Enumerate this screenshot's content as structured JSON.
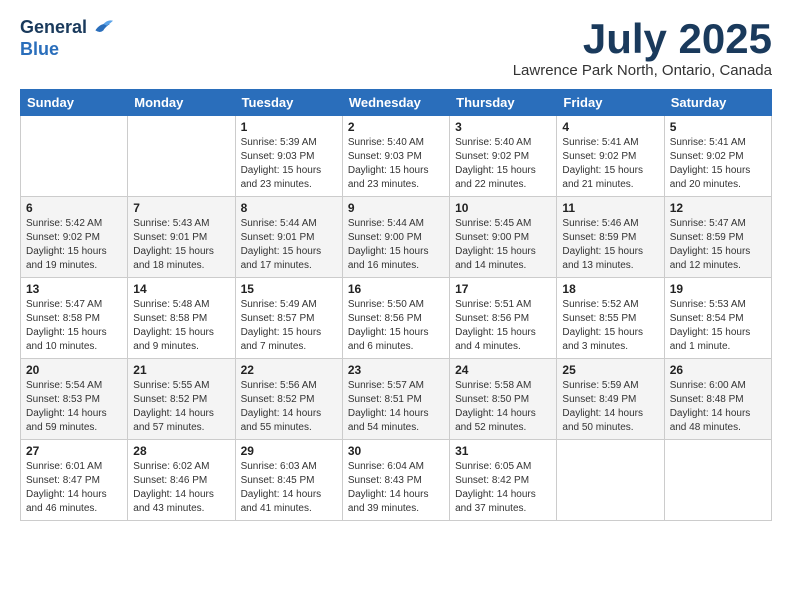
{
  "logo": {
    "general": "General",
    "blue": "Blue"
  },
  "header": {
    "month": "July 2025",
    "location": "Lawrence Park North, Ontario, Canada"
  },
  "weekdays": [
    "Sunday",
    "Monday",
    "Tuesday",
    "Wednesday",
    "Thursday",
    "Friday",
    "Saturday"
  ],
  "weeks": [
    [
      {
        "day": "",
        "sunrise": "",
        "sunset": "",
        "daylight": ""
      },
      {
        "day": "",
        "sunrise": "",
        "sunset": "",
        "daylight": ""
      },
      {
        "day": "1",
        "sunrise": "Sunrise: 5:39 AM",
        "sunset": "Sunset: 9:03 PM",
        "daylight": "Daylight: 15 hours and 23 minutes."
      },
      {
        "day": "2",
        "sunrise": "Sunrise: 5:40 AM",
        "sunset": "Sunset: 9:03 PM",
        "daylight": "Daylight: 15 hours and 23 minutes."
      },
      {
        "day": "3",
        "sunrise": "Sunrise: 5:40 AM",
        "sunset": "Sunset: 9:02 PM",
        "daylight": "Daylight: 15 hours and 22 minutes."
      },
      {
        "day": "4",
        "sunrise": "Sunrise: 5:41 AM",
        "sunset": "Sunset: 9:02 PM",
        "daylight": "Daylight: 15 hours and 21 minutes."
      },
      {
        "day": "5",
        "sunrise": "Sunrise: 5:41 AM",
        "sunset": "Sunset: 9:02 PM",
        "daylight": "Daylight: 15 hours and 20 minutes."
      }
    ],
    [
      {
        "day": "6",
        "sunrise": "Sunrise: 5:42 AM",
        "sunset": "Sunset: 9:02 PM",
        "daylight": "Daylight: 15 hours and 19 minutes."
      },
      {
        "day": "7",
        "sunrise": "Sunrise: 5:43 AM",
        "sunset": "Sunset: 9:01 PM",
        "daylight": "Daylight: 15 hours and 18 minutes."
      },
      {
        "day": "8",
        "sunrise": "Sunrise: 5:44 AM",
        "sunset": "Sunset: 9:01 PM",
        "daylight": "Daylight: 15 hours and 17 minutes."
      },
      {
        "day": "9",
        "sunrise": "Sunrise: 5:44 AM",
        "sunset": "Sunset: 9:00 PM",
        "daylight": "Daylight: 15 hours and 16 minutes."
      },
      {
        "day": "10",
        "sunrise": "Sunrise: 5:45 AM",
        "sunset": "Sunset: 9:00 PM",
        "daylight": "Daylight: 15 hours and 14 minutes."
      },
      {
        "day": "11",
        "sunrise": "Sunrise: 5:46 AM",
        "sunset": "Sunset: 8:59 PM",
        "daylight": "Daylight: 15 hours and 13 minutes."
      },
      {
        "day": "12",
        "sunrise": "Sunrise: 5:47 AM",
        "sunset": "Sunset: 8:59 PM",
        "daylight": "Daylight: 15 hours and 12 minutes."
      }
    ],
    [
      {
        "day": "13",
        "sunrise": "Sunrise: 5:47 AM",
        "sunset": "Sunset: 8:58 PM",
        "daylight": "Daylight: 15 hours and 10 minutes."
      },
      {
        "day": "14",
        "sunrise": "Sunrise: 5:48 AM",
        "sunset": "Sunset: 8:58 PM",
        "daylight": "Daylight: 15 hours and 9 minutes."
      },
      {
        "day": "15",
        "sunrise": "Sunrise: 5:49 AM",
        "sunset": "Sunset: 8:57 PM",
        "daylight": "Daylight: 15 hours and 7 minutes."
      },
      {
        "day": "16",
        "sunrise": "Sunrise: 5:50 AM",
        "sunset": "Sunset: 8:56 PM",
        "daylight": "Daylight: 15 hours and 6 minutes."
      },
      {
        "day": "17",
        "sunrise": "Sunrise: 5:51 AM",
        "sunset": "Sunset: 8:56 PM",
        "daylight": "Daylight: 15 hours and 4 minutes."
      },
      {
        "day": "18",
        "sunrise": "Sunrise: 5:52 AM",
        "sunset": "Sunset: 8:55 PM",
        "daylight": "Daylight: 15 hours and 3 minutes."
      },
      {
        "day": "19",
        "sunrise": "Sunrise: 5:53 AM",
        "sunset": "Sunset: 8:54 PM",
        "daylight": "Daylight: 15 hours and 1 minute."
      }
    ],
    [
      {
        "day": "20",
        "sunrise": "Sunrise: 5:54 AM",
        "sunset": "Sunset: 8:53 PM",
        "daylight": "Daylight: 14 hours and 59 minutes."
      },
      {
        "day": "21",
        "sunrise": "Sunrise: 5:55 AM",
        "sunset": "Sunset: 8:52 PM",
        "daylight": "Daylight: 14 hours and 57 minutes."
      },
      {
        "day": "22",
        "sunrise": "Sunrise: 5:56 AM",
        "sunset": "Sunset: 8:52 PM",
        "daylight": "Daylight: 14 hours and 55 minutes."
      },
      {
        "day": "23",
        "sunrise": "Sunrise: 5:57 AM",
        "sunset": "Sunset: 8:51 PM",
        "daylight": "Daylight: 14 hours and 54 minutes."
      },
      {
        "day": "24",
        "sunrise": "Sunrise: 5:58 AM",
        "sunset": "Sunset: 8:50 PM",
        "daylight": "Daylight: 14 hours and 52 minutes."
      },
      {
        "day": "25",
        "sunrise": "Sunrise: 5:59 AM",
        "sunset": "Sunset: 8:49 PM",
        "daylight": "Daylight: 14 hours and 50 minutes."
      },
      {
        "day": "26",
        "sunrise": "Sunrise: 6:00 AM",
        "sunset": "Sunset: 8:48 PM",
        "daylight": "Daylight: 14 hours and 48 minutes."
      }
    ],
    [
      {
        "day": "27",
        "sunrise": "Sunrise: 6:01 AM",
        "sunset": "Sunset: 8:47 PM",
        "daylight": "Daylight: 14 hours and 46 minutes."
      },
      {
        "day": "28",
        "sunrise": "Sunrise: 6:02 AM",
        "sunset": "Sunset: 8:46 PM",
        "daylight": "Daylight: 14 hours and 43 minutes."
      },
      {
        "day": "29",
        "sunrise": "Sunrise: 6:03 AM",
        "sunset": "Sunset: 8:45 PM",
        "daylight": "Daylight: 14 hours and 41 minutes."
      },
      {
        "day": "30",
        "sunrise": "Sunrise: 6:04 AM",
        "sunset": "Sunset: 8:43 PM",
        "daylight": "Daylight: 14 hours and 39 minutes."
      },
      {
        "day": "31",
        "sunrise": "Sunrise: 6:05 AM",
        "sunset": "Sunset: 8:42 PM",
        "daylight": "Daylight: 14 hours and 37 minutes."
      },
      {
        "day": "",
        "sunrise": "",
        "sunset": "",
        "daylight": ""
      },
      {
        "day": "",
        "sunrise": "",
        "sunset": "",
        "daylight": ""
      }
    ]
  ]
}
